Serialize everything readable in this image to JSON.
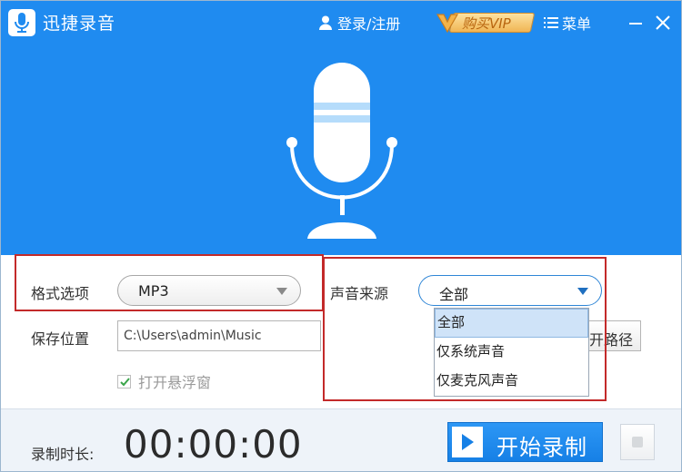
{
  "app": {
    "title": "迅捷录音"
  },
  "header": {
    "login_label": "登录/注册",
    "vip_label": "购买VIP",
    "menu_label": "菜单"
  },
  "settings": {
    "format_label": "格式选项",
    "format_value": "MP3",
    "source_label": "声音来源",
    "source_value": "全部",
    "source_options": [
      "全部",
      "仅系统声音",
      "仅麦克风声音"
    ],
    "save_label": "保存位置",
    "save_path": "C:\\Users\\admin\\Music",
    "open_path_label": "开路径",
    "float_window_label": "打开悬浮窗",
    "float_window_checked": true
  },
  "recording": {
    "duration_label": "录制时长:",
    "timer": "00:00:00",
    "start_label": "开始录制"
  },
  "colors": {
    "header_blue": "#1f8bf0",
    "button_blue": "#1680e6",
    "highlight_red": "#c32a2a",
    "vip_gold": "#f0b554"
  },
  "icons": [
    "app-logo-icon",
    "user-icon",
    "vip-icon",
    "menu-icon",
    "minimize-icon",
    "close-icon",
    "microphone-icon",
    "dropdown-caret-icon",
    "check-icon",
    "play-icon",
    "stop-icon"
  ]
}
